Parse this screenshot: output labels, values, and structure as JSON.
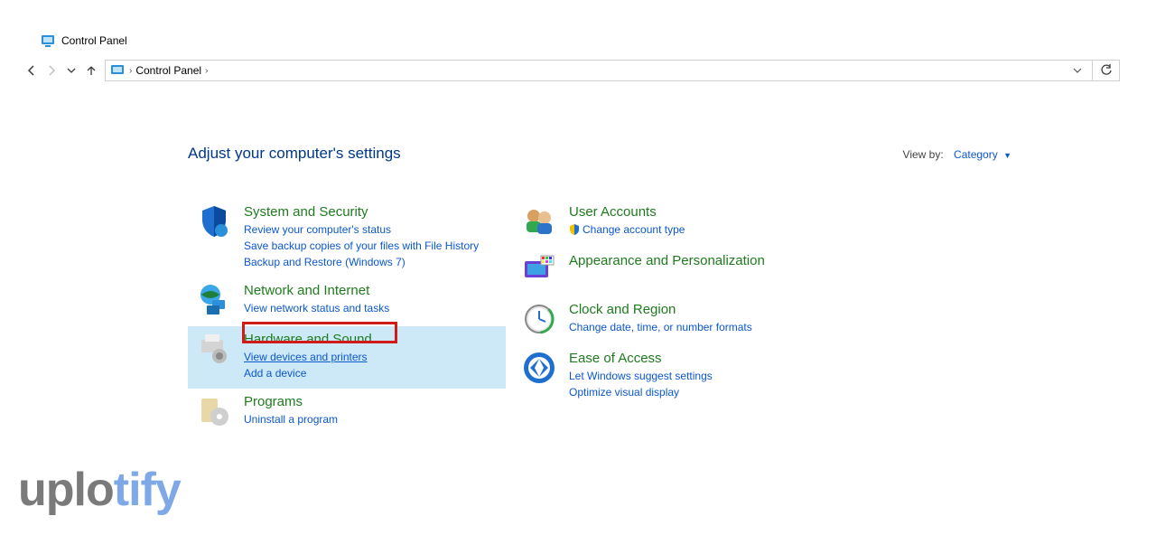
{
  "window": {
    "title": "Control Panel"
  },
  "breadcrumb": {
    "root": "Control Panel"
  },
  "heading": "Adjust your computer's settings",
  "viewby": {
    "label": "View by:",
    "value": "Category"
  },
  "left": [
    {
      "key": "system-security",
      "title": "System and Security",
      "links": [
        "Review your computer's status",
        "Save backup copies of your files with File History",
        "Backup and Restore (Windows 7)"
      ]
    },
    {
      "key": "network-internet",
      "title": "Network and Internet",
      "links": [
        "View network status and tasks"
      ]
    },
    {
      "key": "hardware-sound",
      "title": "Hardware and Sound",
      "links": [
        "View devices and printers",
        "Add a device"
      ],
      "highlighted": true,
      "boxed_link_index": 0
    },
    {
      "key": "programs",
      "title": "Programs",
      "links": [
        "Uninstall a program"
      ]
    }
  ],
  "right": [
    {
      "key": "user-accounts",
      "title": "User Accounts",
      "links": [
        "Change account type"
      ],
      "shield_on_first": true
    },
    {
      "key": "appearance",
      "title": "Appearance and Personalization",
      "links": []
    },
    {
      "key": "clock-region",
      "title": "Clock and Region",
      "links": [
        "Change date, time, or number formats"
      ]
    },
    {
      "key": "ease-of-access",
      "title": "Ease of Access",
      "links": [
        "Let Windows suggest settings",
        "Optimize visual display"
      ]
    }
  ],
  "watermark": {
    "pre": "uplo",
    "blue": "tify"
  }
}
